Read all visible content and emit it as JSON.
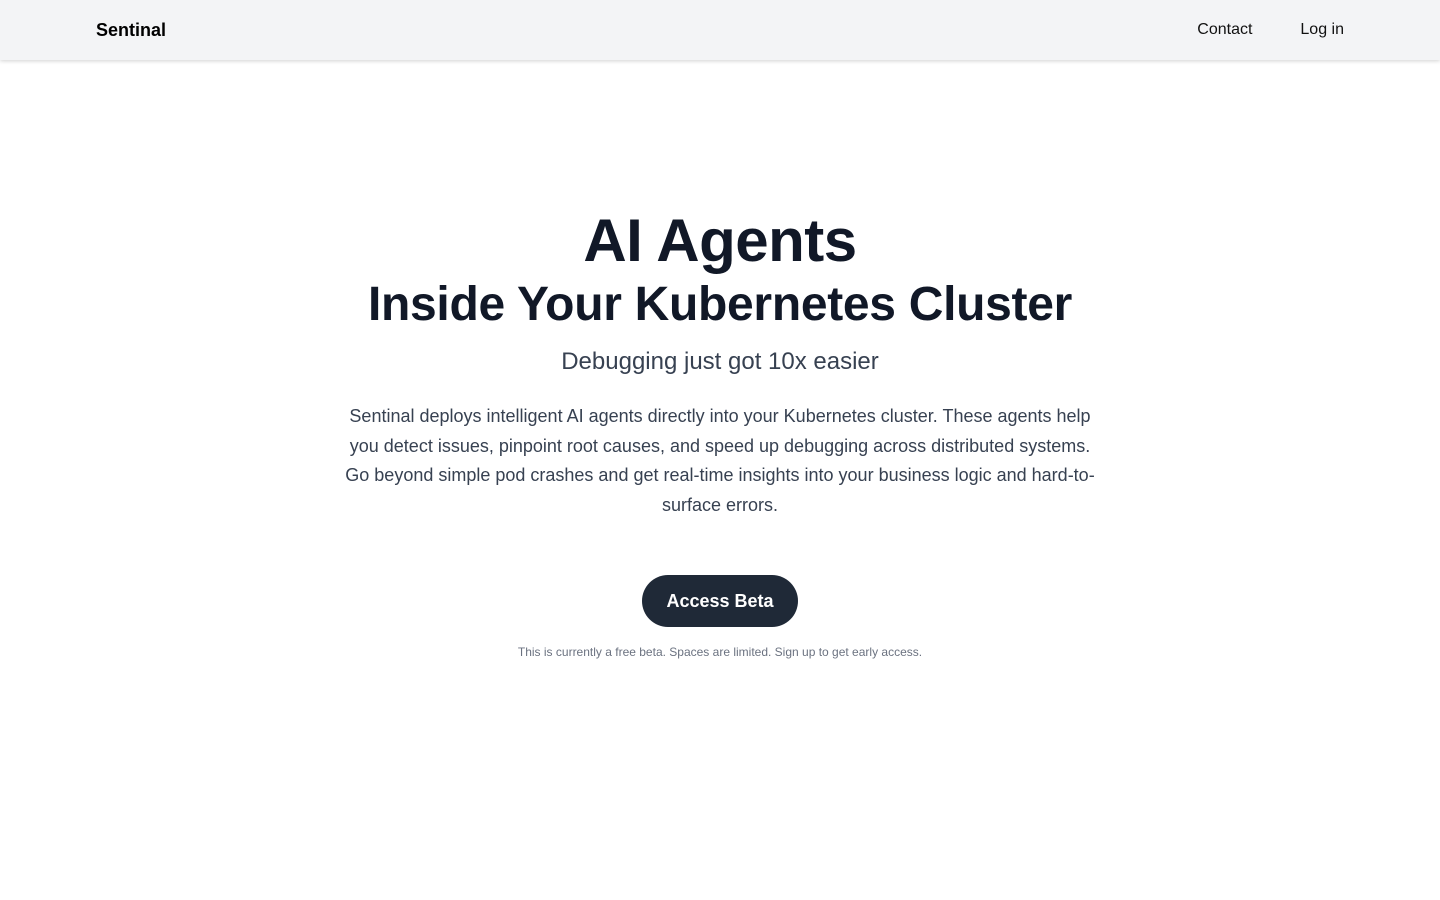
{
  "navbar": {
    "brand": "Sentinal",
    "links": [
      {
        "label": "Contact"
      },
      {
        "label": "Log in"
      }
    ]
  },
  "hero": {
    "title": "AI Agents",
    "subtitle": "Inside Your Kubernetes Cluster",
    "tagline": "Debugging just got 10x easier",
    "description": "Sentinal deploys intelligent AI agents directly into your Kubernetes cluster. These agents help you detect issues, pinpoint root causes, and speed up debugging across distributed systems. Go beyond simple pod crashes and get real-time insights into your business logic and hard-to-surface errors.",
    "cta_label": "Access Beta",
    "footnote": "This is currently a free beta. Spaces are limited. Sign up to get early access."
  },
  "colors": {
    "navbar_bg": "#f3f4f6",
    "heading": "#111827",
    "body_text": "#374151",
    "button_bg": "#1f2937",
    "button_text": "#ffffff",
    "footnote": "#6b7280"
  }
}
